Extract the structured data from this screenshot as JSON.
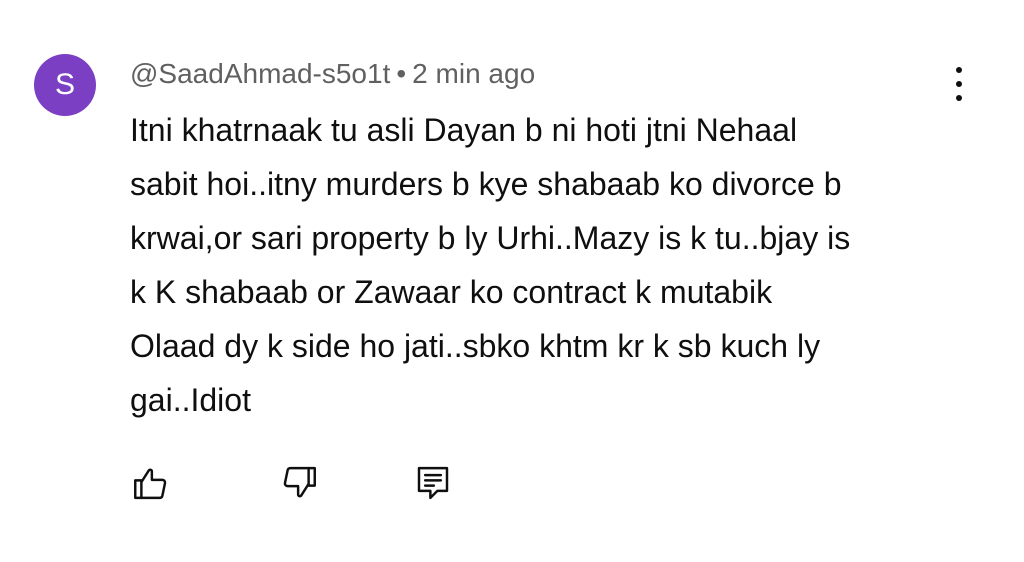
{
  "comment": {
    "avatar_letter": "S",
    "avatar_color": "#7b3fc4",
    "author": "@SaadAhmad-s5o1t",
    "separator": "•",
    "timestamp": "2 min ago",
    "text_lines": [
      "Itni khatrnaak tu asli Dayan b ni hoti jtni Nehaal",
      "sabit hoi..itny murders b kye shabaab ko divorce b",
      "krwai,or sari property b ly Urhi..Mazy is k tu..bjay is",
      "k K shabaab or Zawaar ko contract k mutabik",
      "Olaad dy k side ho jati..sbko khtm kr k sb kuch ly",
      "gai..Idiot"
    ],
    "icons": {
      "menu": "more-vert-icon",
      "like": "thumb-up-icon",
      "dislike": "thumb-down-icon",
      "reply": "reply-comment-icon"
    }
  }
}
